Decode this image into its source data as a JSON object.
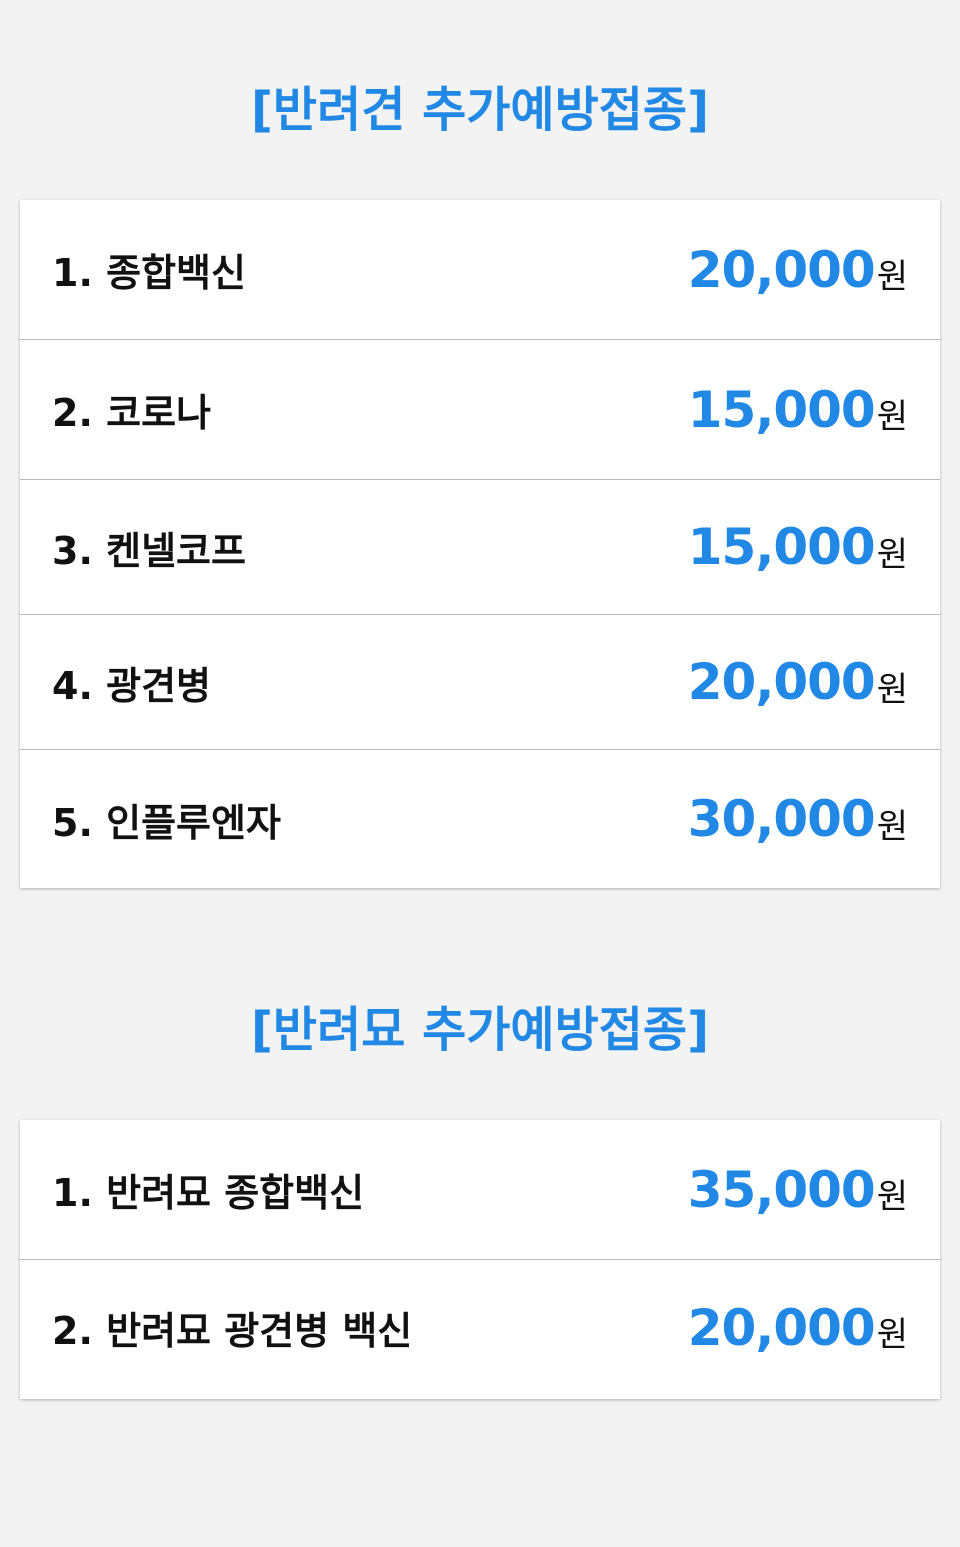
{
  "colors": {
    "accent": "#2188e6",
    "background": "#f3f3f3",
    "card": "#ffffff",
    "text": "#111111"
  },
  "dog": {
    "title": "[반려견 추가예방접종]",
    "items": [
      {
        "label": "1. 종합백신",
        "price": "20,000",
        "unit": "원"
      },
      {
        "label": "2. 코로나",
        "price": "15,000",
        "unit": "원"
      },
      {
        "label": "3. 켄넬코프",
        "price": "15,000",
        "unit": "원"
      },
      {
        "label": "4. 광견병",
        "price": "20,000",
        "unit": "원"
      },
      {
        "label": "5. 인플루엔자",
        "price": "30,000",
        "unit": "원"
      }
    ]
  },
  "cat": {
    "title": "[반려묘 추가예방접종]",
    "items": [
      {
        "label": "1. 반려묘 종합백신",
        "price": "35,000",
        "unit": "원"
      },
      {
        "label": "2. 반려묘 광견병 백신",
        "price": "20,000",
        "unit": "원"
      }
    ]
  }
}
